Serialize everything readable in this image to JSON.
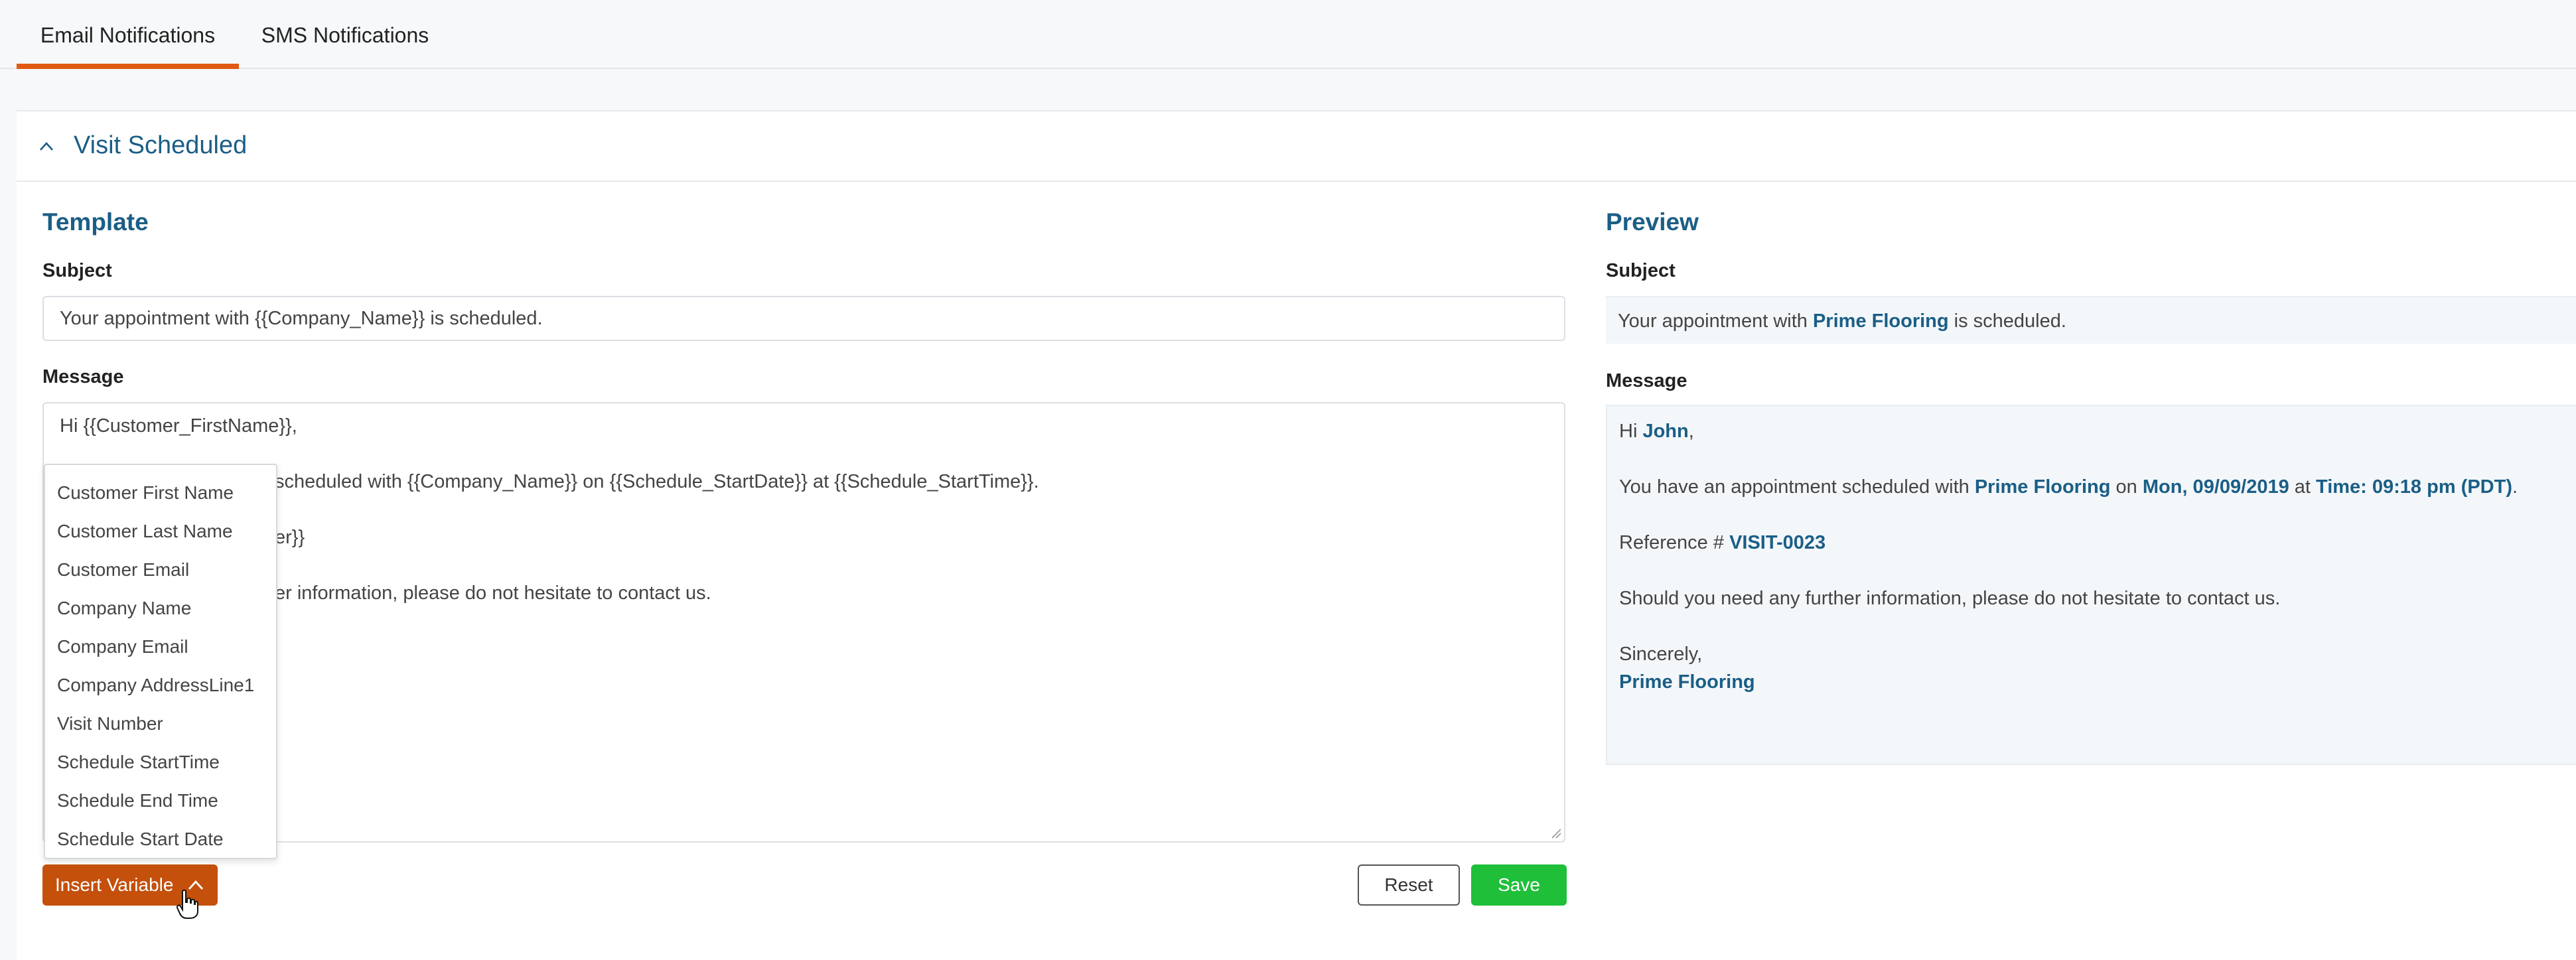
{
  "tabs": {
    "email": "Email Notifications",
    "sms": "SMS Notifications"
  },
  "panel": {
    "title": "Visit Scheduled"
  },
  "template": {
    "heading": "Template",
    "subject_label": "Subject",
    "subject_value": "Your appointment with {{Company_Name}} is scheduled.",
    "message_label": "Message",
    "message_lines": {
      "l1": "Hi {{Customer_FirstName}},",
      "l2": "scheduled with {{Company_Name}} on {{Schedule_StartDate}} at {{Schedule_StartTime}}.",
      "l3": "er}}",
      "l4": "er information, please do not hesitate to contact us."
    }
  },
  "variables": {
    "items": [
      "Customer First Name",
      "Customer Last Name",
      "Customer Email",
      "Company Name",
      "Company Email",
      "Company AddressLine1",
      "Visit Number",
      "Schedule StartTime",
      "Schedule End Time",
      "Schedule Start Date"
    ]
  },
  "actions": {
    "insert_variable": "Insert Variable",
    "reset": "Reset",
    "save": "Save"
  },
  "preview": {
    "heading": "Preview",
    "subject_label": "Subject",
    "subject_pre": "Your appointment with",
    "subject_company": "Prime Flooring",
    "subject_post": "is scheduled.",
    "message_label": "Message",
    "greeting": "Hi",
    "customer_name": "John",
    "greeting_punct": ",",
    "appt_pre": "You have an appointment scheduled with",
    "appt_company": "Prime Flooring",
    "appt_on": "on",
    "appt_date": "Mon, 09/09/2019",
    "appt_at": "at",
    "appt_time": "Time: 09:18 pm (PDT)",
    "appt_end": ".",
    "ref_label": "Reference #",
    "ref_value": "VISIT-0023",
    "further": "Should you need any further information, please do not hesitate to contact us.",
    "sincerely": "Sincerely,",
    "signature": "Prime Flooring"
  },
  "colors": {
    "accent": "#e05a14",
    "heading_blue": "#1b5e86",
    "insert_button": "#c4500c",
    "save_button": "#1fbf3a"
  }
}
